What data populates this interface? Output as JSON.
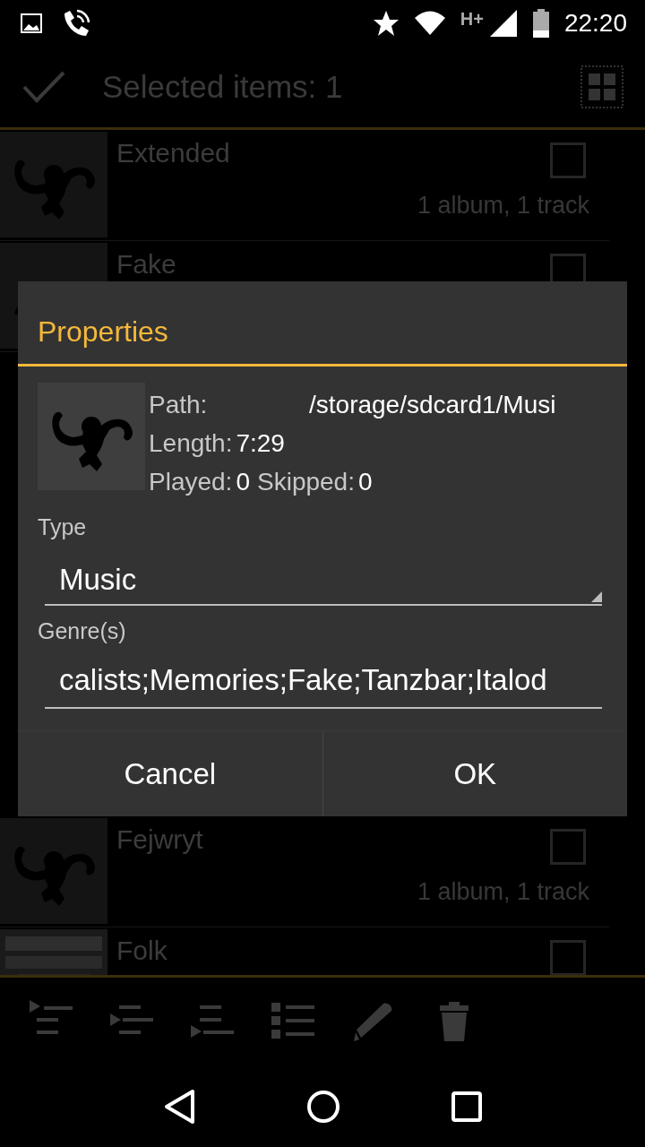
{
  "status_bar": {
    "network": "H+",
    "time": "22:20"
  },
  "action_bar": {
    "title": "Selected items: 1"
  },
  "list": [
    {
      "title": "Extended",
      "subtitle": "1 album, 1 track",
      "checked": false,
      "kind": "monkey"
    },
    {
      "title": "Fake",
      "checked": false,
      "kind": "monkey"
    },
    {
      "title": "Fejwryt",
      "subtitle": "1 album, 1 track",
      "checked": false,
      "kind": "monkey"
    },
    {
      "title": "Folk",
      "checked": false,
      "kind": "picture"
    }
  ],
  "dialog": {
    "title": "Properties",
    "info": [
      {
        "label": "Path:",
        "value": "/storage/sdcard1/Musi"
      },
      {
        "label": "Length:",
        "value": "7:29"
      },
      {
        "label": "Played:",
        "value": "0",
        "label_2": "Skipped:",
        "value_2": "0"
      }
    ],
    "fields": [
      {
        "kind": "dropdown",
        "label": "Type",
        "value": "Music"
      },
      {
        "kind": "text",
        "label": "Genre(s)",
        "value": "calists;Memories;Fake;Tanzbar;Italod"
      }
    ],
    "buttons": [
      "Cancel",
      "OK"
    ]
  },
  "toolbar": [
    {
      "kind": "play-first"
    },
    {
      "kind": "play-next"
    },
    {
      "kind": "play-last"
    },
    {
      "kind": "select"
    },
    {
      "kind": "edit"
    },
    {
      "kind": "delete"
    }
  ]
}
